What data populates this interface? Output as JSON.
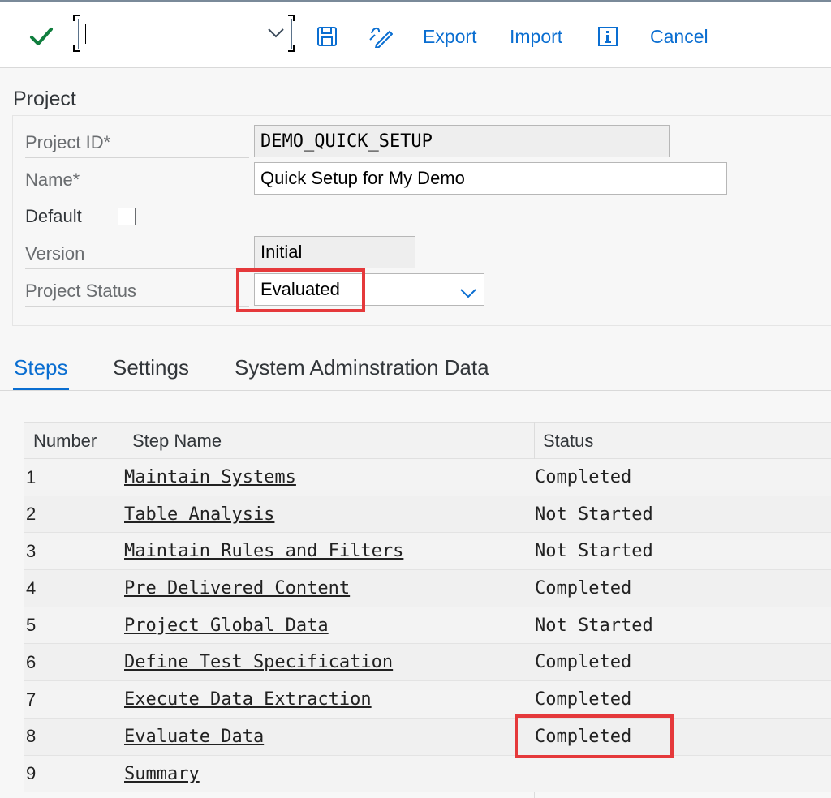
{
  "toolbar": {
    "command_value": "",
    "export_label": "Export",
    "import_label": "Import",
    "cancel_label": "Cancel",
    "icons": [
      "checkmark-icon",
      "save-icon",
      "edit-icon",
      "info-icon"
    ]
  },
  "project": {
    "section_title": "Project",
    "fields": {
      "project_id": {
        "label": "Project ID*",
        "value": "DEMO_QUICK_SETUP"
      },
      "name": {
        "label": "Name*",
        "value": "Quick Setup for My Demo"
      },
      "default": {
        "label": "Default",
        "checked": false
      },
      "version": {
        "label": "Version",
        "value": "Initial"
      },
      "project_status": {
        "label": "Project Status",
        "value": "Evaluated"
      }
    }
  },
  "tabs": [
    {
      "label": "Steps",
      "active": true
    },
    {
      "label": "Settings",
      "active": false
    },
    {
      "label": "System Adminstration Data",
      "active": false
    }
  ],
  "steps_table": {
    "headers": {
      "number": "Number",
      "step_name": "Step Name",
      "status": "Status"
    },
    "rows": [
      {
        "number": "1",
        "step_name": "Maintain Systems",
        "status": "Completed"
      },
      {
        "number": "2",
        "step_name": "Table Analysis",
        "status": "Not Started"
      },
      {
        "number": "3",
        "step_name": "Maintain Rules and Filters",
        "status": "Not Started"
      },
      {
        "number": "4",
        "step_name": "Pre Delivered Content",
        "status": "Completed"
      },
      {
        "number": "5",
        "step_name": "Project Global Data",
        "status": "Not Started"
      },
      {
        "number": "6",
        "step_name": "Define Test Specification",
        "status": "Completed"
      },
      {
        "number": "7",
        "step_name": "Execute Data Extraction",
        "status": "Completed"
      },
      {
        "number": "8",
        "step_name": "Evaluate Data",
        "status": "Completed"
      },
      {
        "number": "9",
        "step_name": "Summary",
        "status": ""
      }
    ]
  },
  "colors": {
    "accent": "#0a6ed1",
    "highlight": "#e5393b",
    "check": "#107e3e"
  }
}
